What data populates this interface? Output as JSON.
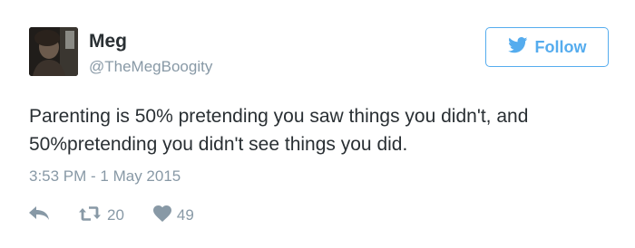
{
  "user": {
    "display_name": "Meg",
    "handle": "@TheMegBoogity"
  },
  "follow_button": {
    "label": "Follow",
    "icon": "twitter-bird-icon"
  },
  "tweet": {
    "text": "Parenting is 50% pretending you saw things you didn't, and\n50%pretending you didn't see things you did.",
    "timestamp": "3:53 PM - 1 May 2015"
  },
  "actions": {
    "reply_icon": "reply-arrow-icon",
    "retweet_icon": "retweet-icon",
    "retweet_count": "20",
    "like_icon": "heart-icon",
    "like_count": "49"
  },
  "colors": {
    "accent": "#55acee",
    "text": "#292f33",
    "muted": "#8899a6"
  }
}
